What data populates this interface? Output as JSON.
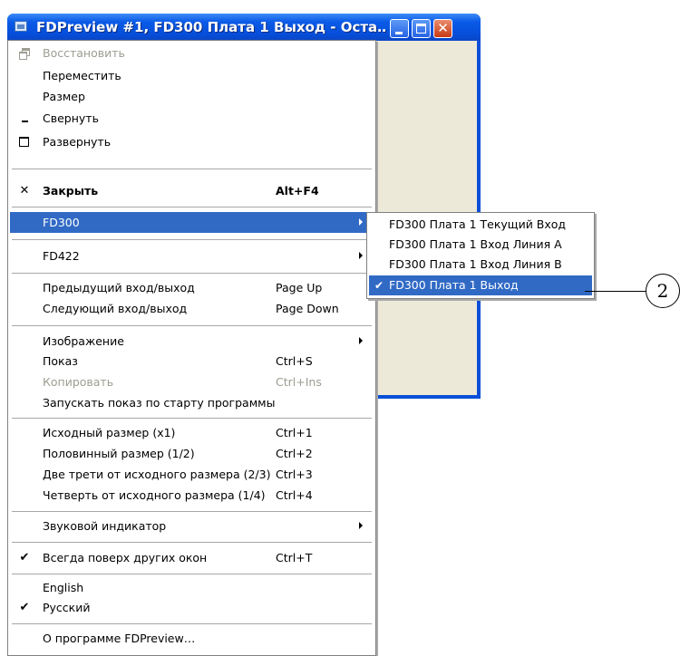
{
  "window": {
    "title": "FDPreview #1, FD300 Плата 1 Выход - Оста…",
    "min_label": "minimize",
    "max_label": "maximize",
    "close_glyph": "✕"
  },
  "menu": {
    "restore": "Восстановить",
    "move": "Переместить",
    "size": "Размер",
    "minimize": "Свернуть",
    "maximize": "Развернуть",
    "close": "Закрыть",
    "close_shortcut": "Alt+F4",
    "fd300": "FD300",
    "fd422": "FD422",
    "prev": "Предыдущий вход/выход",
    "prev_shortcut": "Page Up",
    "next": "Следующий вход/выход",
    "next_shortcut": "Page Down",
    "image": "Изображение",
    "show": "Показ",
    "show_shortcut": "Ctrl+S",
    "copy": "Копировать",
    "copy_shortcut": "Ctrl+Ins",
    "autostart": "Запускать показ по старту программы",
    "size_x1": "Исходный размер (x1)",
    "size_x1_shortcut": "Ctrl+1",
    "size_half": "Половинный размер (1/2)",
    "size_half_shortcut": "Ctrl+2",
    "size_two_thirds": "Две трети от исходного размера (2/3)",
    "size_two_thirds_shortcut": "Ctrl+3",
    "size_quarter": "Четверть от исходного размера (1/4)",
    "size_quarter_shortcut": "Ctrl+4",
    "audio": "Звуковой индикатор",
    "always_on_top": "Всегда поверх других окон",
    "always_on_top_shortcut": "Ctrl+T",
    "english": "English",
    "russian": "Русский",
    "about": "О программе FDPreview…",
    "check_glyph": "✔",
    "close_x_glyph": "✕"
  },
  "submenu": {
    "items": [
      "FD300 Плата 1 Текущий Вход",
      "FD300 Плата 1 Вход Линия A",
      "FD300 Плата 1 Вход Линия B",
      "FD300 Плата 1 Выход"
    ],
    "check_glyph": "✔"
  },
  "callout": {
    "number": "2"
  },
  "colors": {
    "highlight": "#316ac5",
    "titlebar": "#0550dc",
    "client": "#ece9d8"
  }
}
